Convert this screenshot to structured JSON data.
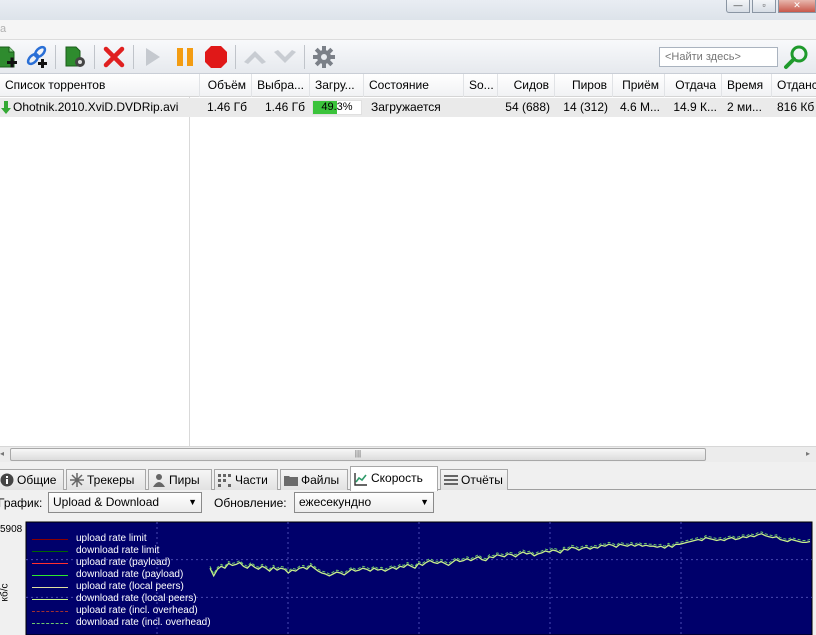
{
  "menubar": {
    "item": "а"
  },
  "toolbar": {
    "icons": [
      "add-torrent-icon",
      "add-link-icon",
      "create-torrent-icon",
      "remove-icon",
      "start-icon",
      "pause-icon",
      "stop-icon",
      "move-up-icon",
      "move-down-icon",
      "settings-icon",
      "search-icon"
    ],
    "search_placeholder": "<Найти здесь>"
  },
  "list": {
    "columns": [
      {
        "key": "name",
        "label": "Список торрентов"
      },
      {
        "key": "size",
        "label": "Объём"
      },
      {
        "key": "selected",
        "label": "Выбра..."
      },
      {
        "key": "done",
        "label": "Загру..."
      },
      {
        "key": "status",
        "label": "Состояние"
      },
      {
        "key": "source",
        "label": "So..."
      },
      {
        "key": "seeds",
        "label": "Сидов"
      },
      {
        "key": "peers",
        "label": "Пиров"
      },
      {
        "key": "down",
        "label": "Приём"
      },
      {
        "key": "up",
        "label": "Отдача"
      },
      {
        "key": "eta",
        "label": "Время"
      },
      {
        "key": "uploaded",
        "label": "Отданс"
      }
    ],
    "rows": [
      {
        "name": "Ohotnik.2010.XviD.DVDRip.avi",
        "size": "1.46 Гб",
        "selected": "1.46 Гб",
        "progress": 49.3,
        "progress_text": "49.3%",
        "status": "Загружается",
        "source": "",
        "seeds": "54 (688)",
        "peers": "14 (312)",
        "down": "4.6 М...",
        "up": "14.9 К...",
        "eta": "2 ми...",
        "uploaded": "816 Кб"
      }
    ]
  },
  "scroll": {
    "grip": "|||"
  },
  "tabs": [
    {
      "label": "Общие",
      "icon": "info-icon"
    },
    {
      "label": "Трекеры",
      "icon": "trackers-icon"
    },
    {
      "label": "Пиры",
      "icon": "peers-icon"
    },
    {
      "label": "Части",
      "icon": "pieces-icon"
    },
    {
      "label": "Файлы",
      "icon": "files-icon"
    },
    {
      "label": "Скорость",
      "icon": "speed-chart-icon",
      "active": true
    },
    {
      "label": "Отчёты",
      "icon": "logs-icon"
    }
  ],
  "graph_options": {
    "graph_label": "График:",
    "graph_value": "Upload & Download",
    "update_label": "Обновление:",
    "update_value": "ежесекундно"
  },
  "chart_data": {
    "type": "line",
    "y_max_label": "5908",
    "ylabel": "кб/с",
    "ylim": [
      0,
      5908
    ],
    "grid": true,
    "background": "#00006b",
    "legend_position": "top-left",
    "legend": [
      {
        "name": "upload rate limit",
        "color": "#8b0000",
        "dash": "solid"
      },
      {
        "name": "download rate limit",
        "color": "#006400",
        "dash": "solid"
      },
      {
        "name": "upload rate (payload)",
        "color": "#ff3030",
        "dash": "solid"
      },
      {
        "name": "download rate (payload)",
        "color": "#2ee62e",
        "dash": "solid"
      },
      {
        "name": "upload rate (local peers)",
        "color": "#e0e0a0",
        "dash": "solid"
      },
      {
        "name": "download rate (local peers)",
        "color": "#c8f08c",
        "dash": "solid"
      },
      {
        "name": "upload rate (incl. overhead)",
        "color": "#a03030",
        "dash": "dashed"
      },
      {
        "name": "download rate (incl. overhead)",
        "color": "#6ec86e",
        "dash": "dashed"
      }
    ],
    "series": [
      {
        "name": "download rate (payload)",
        "color": "#c8f08c",
        "values": [
          3700,
          3300,
          3650,
          3800,
          3700,
          3950,
          3850,
          3900,
          4000,
          3800,
          3700,
          3900,
          3750,
          3650,
          3800,
          3700,
          3550,
          3750,
          3600,
          3700,
          3650,
          3450,
          3600,
          3550,
          3700,
          3750,
          3650,
          3850,
          3700,
          3550,
          3450,
          3400,
          3300,
          3400,
          3500,
          3450,
          3350,
          3500,
          3650,
          3550,
          3600,
          3700,
          3650,
          3550,
          3700,
          3600,
          3650,
          3550,
          3650,
          3750,
          3650,
          3800,
          3750,
          3900,
          3800,
          3700,
          3950,
          3850,
          4000,
          4100,
          4000,
          3950,
          4050,
          3950,
          3850,
          4000,
          4150,
          4050,
          4100,
          4200,
          4100,
          4200,
          4300,
          4150,
          4100,
          4300,
          4250,
          4400,
          4350,
          4300,
          4450,
          4400,
          4300,
          4450,
          4550,
          4450,
          4500,
          4350,
          4450,
          4500,
          4600,
          4550,
          4650,
          4600,
          4500,
          4700,
          4650,
          4800,
          4750,
          4650,
          4750,
          4800,
          4700,
          4800,
          4750,
          4900,
          4850,
          4950,
          4900,
          4800,
          4950,
          4900,
          4850,
          4950,
          4850,
          4950,
          4850,
          4900,
          4850,
          4850,
          4800,
          4850,
          4750,
          4900,
          4800,
          4950,
          4950,
          5000,
          5050,
          5100,
          5150,
          5200,
          5150,
          5300,
          5250,
          5200,
          5150,
          5200,
          5150,
          5250,
          5300,
          5200,
          5250,
          5350,
          5300,
          5400,
          5350,
          5450,
          5500,
          5400,
          5350,
          5300,
          5350,
          5200,
          5150,
          5100,
          5200,
          5150,
          5100,
          5050,
          5050,
          5100
        ]
      },
      {
        "name": "download rate (incl. overhead)",
        "color": "#6ec86e",
        "values": [
          3800,
          3400,
          3750,
          3900,
          3800,
          4050,
          3950,
          4000,
          4100,
          3900,
          3800,
          4000,
          3850,
          3750,
          3900,
          3800,
          3650,
          3850,
          3700,
          3800,
          3750,
          3550,
          3700,
          3650,
          3800,
          3850,
          3750,
          3950,
          3800,
          3650,
          3550,
          3500,
          3400,
          3500,
          3600,
          3550,
          3450,
          3600,
          3750,
          3650,
          3700,
          3800,
          3750,
          3650,
          3800,
          3700,
          3750,
          3650,
          3750,
          3850,
          3750,
          3900,
          3850,
          4000,
          3900,
          3800,
          4050,
          3950,
          4100,
          4200,
          4100,
          4050,
          4150,
          4050,
          3950,
          4100,
          4250,
          4150,
          4200,
          4300,
          4200,
          4300,
          4400,
          4250,
          4200,
          4400,
          4350,
          4500,
          4450,
          4400,
          4550,
          4500,
          4400,
          4550,
          4650,
          4550,
          4600,
          4450,
          4550,
          4600,
          4700,
          4650,
          4750,
          4700,
          4600,
          4800,
          4750,
          4900,
          4850,
          4750,
          4850,
          4900,
          4800,
          4900,
          4850,
          5000,
          4950,
          5050,
          5000,
          4900,
          5050,
          5000,
          4950,
          5050,
          4950,
          5050,
          4950,
          5000,
          4950,
          4950,
          4900,
          4950,
          4850,
          5000,
          4900,
          5050,
          5050,
          5100,
          5150,
          5200,
          5250,
          5300,
          5250,
          5400,
          5350,
          5300,
          5250,
          5300,
          5250,
          5350,
          5400,
          5300,
          5350,
          5450,
          5400,
          5500,
          5450,
          5550,
          5600,
          5500,
          5450,
          5400,
          5450,
          5300,
          5250,
          5200,
          5300,
          5250,
          5200,
          5150,
          5150,
          5200
        ]
      }
    ]
  }
}
